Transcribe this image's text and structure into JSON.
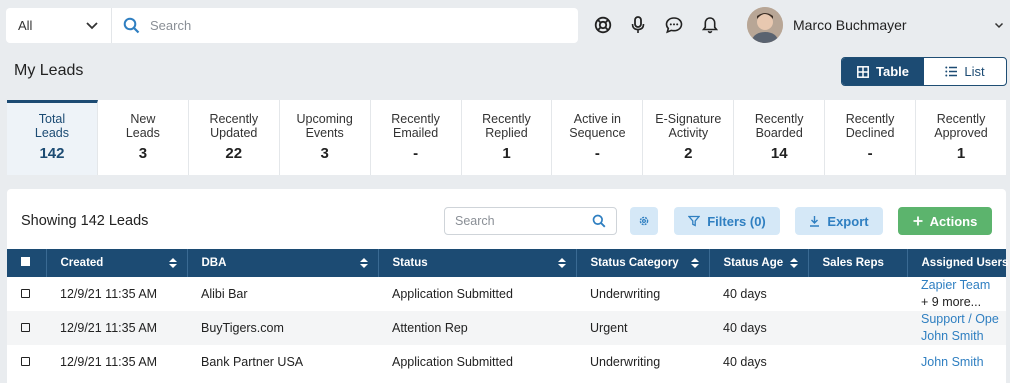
{
  "topbar": {
    "scope_value": "All",
    "search_placeholder": "Search",
    "icons": [
      "help-lifebuoy-icon",
      "microphone-icon",
      "chat-icon",
      "bell-icon"
    ],
    "user_name": "Marco Buchmayer"
  },
  "page": {
    "title": "My Leads",
    "view_toggle": {
      "table_label": "Table",
      "list_label": "List",
      "active": "Table"
    }
  },
  "stats": [
    {
      "label_1": "Total",
      "label_2": "Leads",
      "value": "142",
      "active": true
    },
    {
      "label_1": "New",
      "label_2": "Leads",
      "value": "3"
    },
    {
      "label_1": "Recently",
      "label_2": "Updated",
      "value": "22"
    },
    {
      "label_1": "Upcoming",
      "label_2": "Events",
      "value": "3"
    },
    {
      "label_1": "Recently",
      "label_2": "Emailed",
      "value": "-"
    },
    {
      "label_1": "Recently",
      "label_2": "Replied",
      "value": "1"
    },
    {
      "label_1": "Active in",
      "label_2": "Sequence",
      "value": "-"
    },
    {
      "label_1": "E-Signature",
      "label_2": "Activity",
      "value": "2"
    },
    {
      "label_1": "Recently",
      "label_2": "Boarded",
      "value": "14"
    },
    {
      "label_1": "Recently",
      "label_2": "Declined",
      "value": "-"
    },
    {
      "label_1": "Recently",
      "label_2": "Approved",
      "value": "1"
    }
  ],
  "table_panel": {
    "showing_text": "Showing 142 Leads",
    "search_placeholder": "Search",
    "filters_label": "Filters (0)",
    "export_label": "Export",
    "actions_label": "Actions"
  },
  "table": {
    "columns": [
      "Created",
      "DBA",
      "Status",
      "Status Category",
      "Status Age",
      "Sales Reps",
      "Assigned Users"
    ],
    "rows": [
      {
        "created": "12/9/21 11:35 AM",
        "dba": "Alibi Bar",
        "status": "Application Submitted",
        "category": "Underwriting",
        "age": "40 days",
        "reps": "",
        "assigned_1": "Zapier Team",
        "assigned_2": "+ 9 more..."
      },
      {
        "created": "12/9/21 11:35 AM",
        "dba": "BuyTigers.com",
        "status": "Attention Rep",
        "category": "Urgent",
        "age": "40 days",
        "reps": "",
        "assigned_1": "Support / Ope",
        "assigned_2": "John Smith"
      },
      {
        "created": "12/9/21 11:35 AM",
        "dba": "Bank Partner USA",
        "status": "Application Submitted",
        "category": "Underwriting",
        "age": "40 days",
        "reps": "",
        "assigned_1": "John Smith",
        "assigned_2": ""
      }
    ]
  },
  "colors": {
    "primary": "#1c4b73",
    "link": "#2f7fc1",
    "action_green": "#5cb46d",
    "light_button": "#d5e8f7"
  }
}
